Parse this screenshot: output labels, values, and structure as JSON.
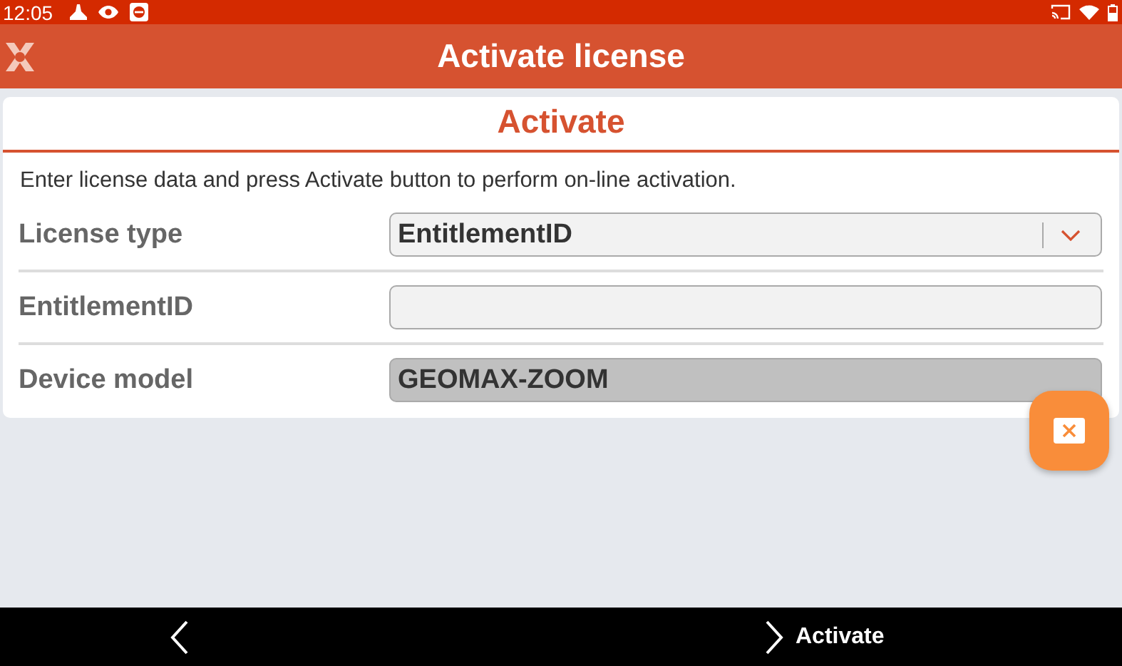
{
  "status_bar": {
    "time": "12:05"
  },
  "header": {
    "title": "Activate license"
  },
  "card": {
    "title": "Activate",
    "description": "Enter license data and press Activate button to perform on-line activation.",
    "rows": [
      {
        "label": "License type",
        "kind": "dropdown",
        "value": "EntitlementID",
        "disabled": false
      },
      {
        "label": "EntitlementID",
        "kind": "input",
        "disabled": false
      },
      {
        "label": "Device model",
        "kind": "input",
        "value": "GEOMAX-ZOOM",
        "disabled": true
      }
    ]
  },
  "bottom_bar": {
    "next_label": "Activate"
  }
}
